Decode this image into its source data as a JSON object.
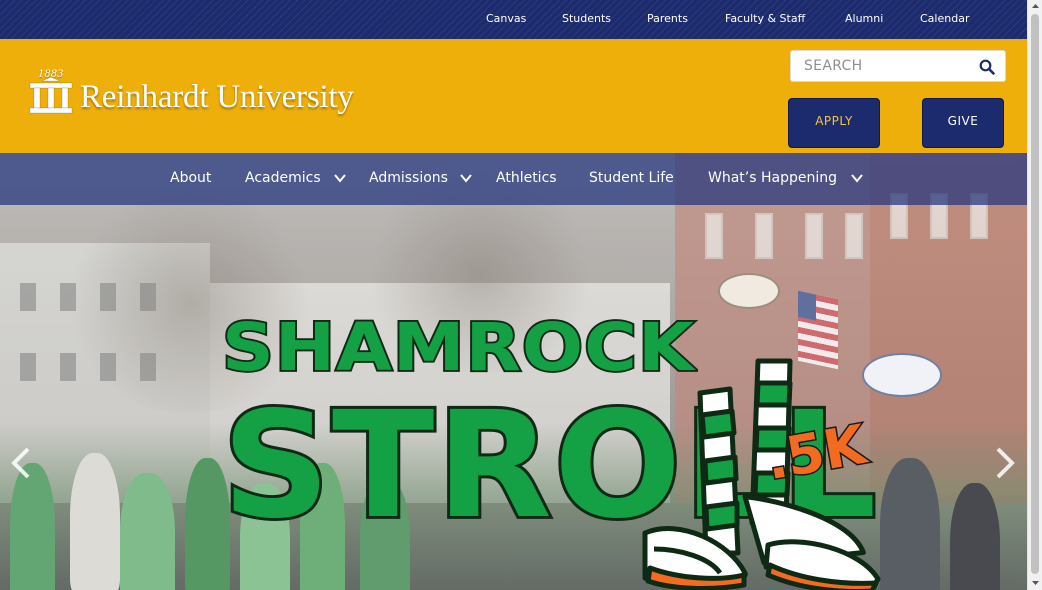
{
  "utility_nav": {
    "links": [
      {
        "label": "Canvas"
      },
      {
        "label": "Students"
      },
      {
        "label": "Parents"
      },
      {
        "label": "Faculty & Staff"
      },
      {
        "label": "Alumni"
      },
      {
        "label": "Calendar"
      }
    ]
  },
  "header": {
    "logo_year": "1883",
    "logo_text": "Reinhardt University",
    "search": {
      "placeholder": "SEARCH",
      "icon": "search-icon"
    },
    "apply_label": "APPLY",
    "give_label": "GIVE"
  },
  "main_nav": {
    "items": [
      {
        "label": "About",
        "has_dropdown": false
      },
      {
        "label": "Academics",
        "has_dropdown": true
      },
      {
        "label": "Admissions",
        "has_dropdown": true
      },
      {
        "label": "Athletics",
        "has_dropdown": false
      },
      {
        "label": "Student Life",
        "has_dropdown": false
      },
      {
        "label": "What’s Happening",
        "has_dropdown": true
      }
    ]
  },
  "hero": {
    "title_line1": "SHAMROCK",
    "title_line2": "STROLL",
    "distance": ".5K",
    "prev_icon": "chevron-left-icon",
    "next_icon": "chevron-right-icon"
  },
  "colors": {
    "utility_bar": "#1c2a6e",
    "header_gold": "#eeaf0b",
    "button_navy": "#1c2a6e",
    "apply_text": "#f4c43a",
    "shamrock_green": "#14a045",
    "orange": "#f36a21"
  }
}
